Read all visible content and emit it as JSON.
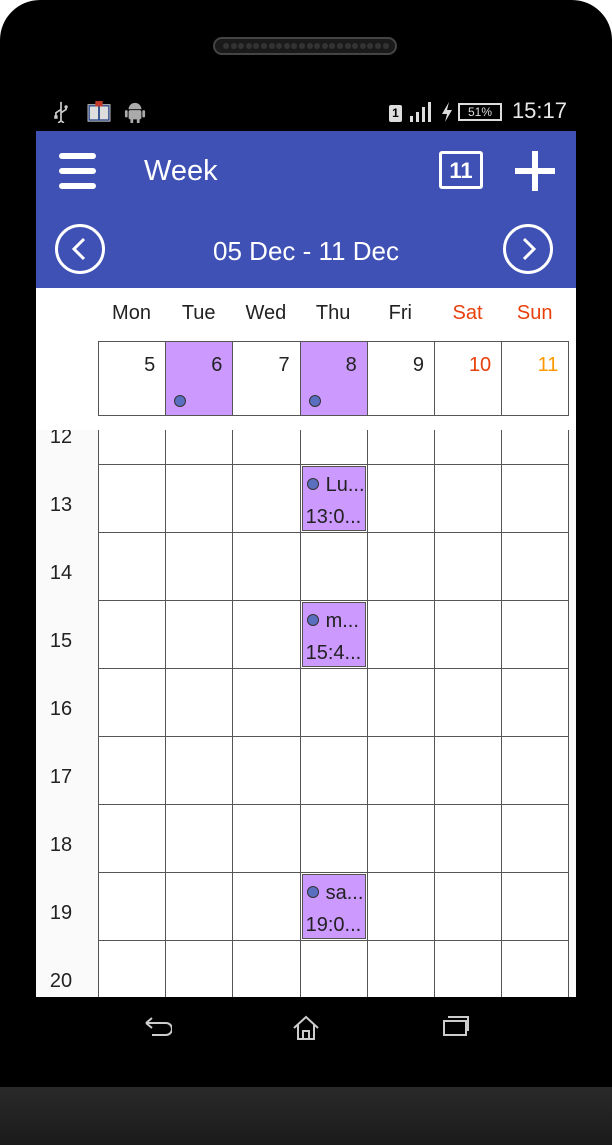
{
  "status_bar": {
    "time": "15:17",
    "battery": "51%",
    "sim": "1",
    "icons": [
      "usb-icon",
      "book-icon",
      "android-icon",
      "sim-icon",
      "signal-icon",
      "charging-icon",
      "battery-icon"
    ]
  },
  "app_bar": {
    "title": "Week",
    "today_label": "11",
    "menu_icon": "hamburger-icon",
    "add_icon": "plus-icon"
  },
  "nav": {
    "range": "05 Dec - 11 Dec",
    "prev_icon": "chevron-left-icon",
    "next_icon": "chevron-right-icon"
  },
  "days": [
    {
      "name": "Mon",
      "date": "5",
      "has_event": false,
      "highlight": false
    },
    {
      "name": "Tue",
      "date": "6",
      "has_event": true,
      "highlight": true
    },
    {
      "name": "Wed",
      "date": "7",
      "has_event": false,
      "highlight": false
    },
    {
      "name": "Thu",
      "date": "8",
      "has_event": true,
      "highlight": true
    },
    {
      "name": "Fri",
      "date": "9",
      "has_event": false,
      "highlight": false
    },
    {
      "name": "Sat",
      "date": "10",
      "has_event": false,
      "highlight": false
    },
    {
      "name": "Sun",
      "date": "11",
      "has_event": false,
      "highlight": false
    }
  ],
  "colors": {
    "primary": "#3f51b5",
    "event": "#cc99ff",
    "weekend_name": "#e8400c",
    "saturday_date": "#e8400c",
    "sunday_date": "#ff9800",
    "event_dot": "#5a6fc0"
  },
  "hours": [
    "12",
    "13",
    "14",
    "15",
    "16",
    "17",
    "18",
    "19",
    "20"
  ],
  "events": [
    {
      "day": 3,
      "hour": "13",
      "title": "Lu...",
      "time": "13:0..."
    },
    {
      "day": 3,
      "hour": "15",
      "title": "m...",
      "time": "15:4..."
    },
    {
      "day": 3,
      "hour": "19",
      "title": "sa...",
      "time": "19:0..."
    }
  ],
  "soft_keys": [
    "back-icon",
    "home-icon",
    "recent-apps-icon"
  ]
}
